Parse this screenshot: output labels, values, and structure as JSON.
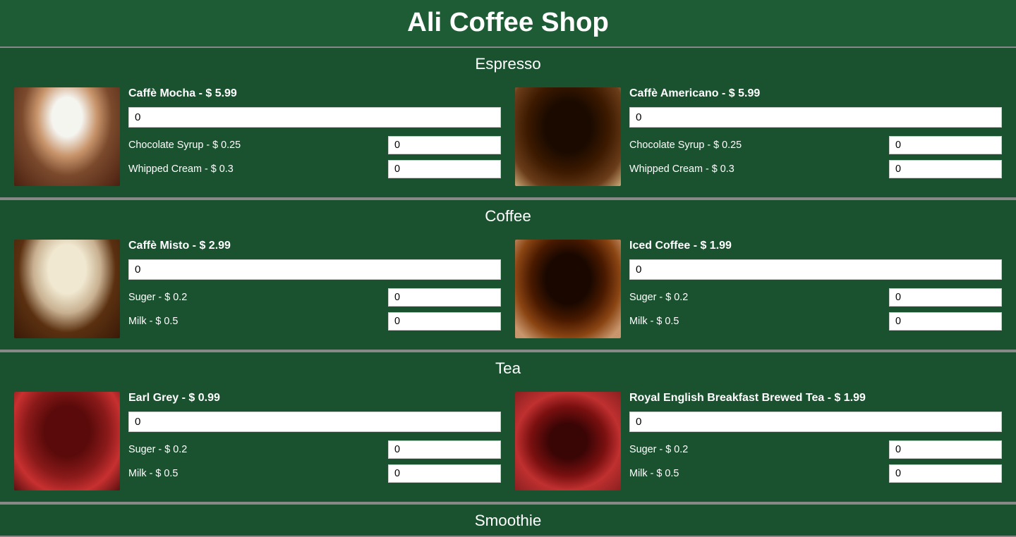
{
  "title": "Ali Coffee Shop",
  "categories": [
    {
      "id": "espresso",
      "label": "Espresso",
      "items": [
        {
          "id": "caffe-mocha",
          "name": "Caffè Mocha - $ 5.99",
          "img_class": "img-caffe-mocha",
          "qty_value": "0",
          "addons": [
            {
              "label": "Chocolate Syrup - $ 0.25",
              "value": "0"
            },
            {
              "label": "Whipped Cream - $ 0.3",
              "value": "0"
            }
          ]
        },
        {
          "id": "caffe-americano",
          "name": "Caffè Americano - $ 5.99",
          "img_class": "img-caffe-americano",
          "qty_value": "0",
          "addons": [
            {
              "label": "Chocolate Syrup - $ 0.25",
              "value": "0"
            },
            {
              "label": "Whipped Cream - $ 0.3",
              "value": "0"
            }
          ]
        }
      ]
    },
    {
      "id": "coffee",
      "label": "Coffee",
      "items": [
        {
          "id": "caffe-misto",
          "name": "Caffè Misto - $ 2.99",
          "img_class": "img-caffe-misto",
          "qty_value": "0",
          "addons": [
            {
              "label": "Suger - $ 0.2",
              "value": "0"
            },
            {
              "label": "Milk - $ 0.5",
              "value": "0"
            }
          ]
        },
        {
          "id": "iced-coffee",
          "name": "Iced Coffee - $ 1.99",
          "img_class": "img-iced-coffee",
          "qty_value": "0",
          "addons": [
            {
              "label": "Suger - $ 0.2",
              "value": "0"
            },
            {
              "label": "Milk - $ 0.5",
              "value": "0"
            }
          ]
        }
      ]
    },
    {
      "id": "tea",
      "label": "Tea",
      "items": [
        {
          "id": "earl-grey",
          "name": "Earl Grey - $ 0.99",
          "img_class": "img-earl-grey",
          "qty_value": "0",
          "addons": [
            {
              "label": "Suger - $ 0.2",
              "value": "0"
            },
            {
              "label": "Milk - $ 0.5",
              "value": "0"
            }
          ]
        },
        {
          "id": "royal-english",
          "name": "Royal English Breakfast Brewed Tea - $ 1.99",
          "img_class": "img-royal-english",
          "qty_value": "0",
          "addons": [
            {
              "label": "Suger - $ 0.2",
              "value": "0"
            },
            {
              "label": "Milk - $ 0.5",
              "value": "0"
            }
          ]
        }
      ]
    },
    {
      "id": "smoothie",
      "label": "Smoothie",
      "items": []
    }
  ]
}
